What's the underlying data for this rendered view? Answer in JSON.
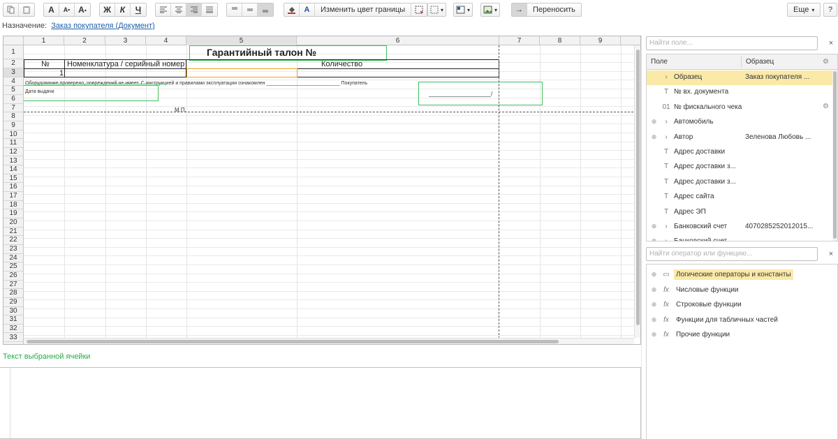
{
  "toolbar": {
    "change_border_color": "Изменить цвет границы",
    "wrap": "Переносить",
    "more": "Еще",
    "help": "?",
    "bold_glyph": "Ж",
    "italic_glyph": "К",
    "underline_glyph": "Ч",
    "font_glyph": "A",
    "dropdown_glyph": "▾"
  },
  "purpose": {
    "label": "Назначение:",
    "link": "Заказ покупателя (Документ)"
  },
  "sheet": {
    "columns": [
      "1",
      "2",
      "3",
      "4",
      "5",
      "6",
      "7",
      "8",
      "9"
    ],
    "rows": [
      "1",
      "2",
      "3",
      "4",
      "5",
      "6",
      "7",
      "8",
      "9",
      "10",
      "11",
      "12",
      "13",
      "14",
      "15",
      "16",
      "17",
      "18",
      "19",
      "20",
      "21",
      "22",
      "23",
      "24",
      "25",
      "26",
      "27",
      "28",
      "29",
      "30",
      "31",
      "32",
      "33"
    ],
    "title": "Гарантийный талон №",
    "header_no": "№",
    "header_item": "Номенклатура / серийный номер",
    "header_qty": "Количество",
    "row3_value": "1",
    "equipment_text": "Оборудование проверено, повреждений не имеет. С инструкцией и правилами эксплуатации ознакомлен ___________________________ Покупатель",
    "issue_date": "Дата выдачи",
    "buyer_sign": "____________________/",
    "stamp": "М.П."
  },
  "cell_text": {
    "label": "Текст выбранной ячейки"
  },
  "fields": {
    "search_placeholder": "Найти поле...",
    "head_field": "Поле",
    "head_sample": "Образец",
    "items": [
      {
        "expander": "",
        "icon": "›",
        "name": "Образец",
        "sample": "Заказ покупателя ...",
        "extra": ""
      },
      {
        "expander": "",
        "icon": "T",
        "name": "№ вх. документа",
        "sample": "",
        "extra": ""
      },
      {
        "expander": "",
        "icon": "01",
        "name": "№ фискального чека",
        "sample": "",
        "extra": "⚙"
      },
      {
        "expander": "⊕",
        "icon": "›",
        "name": "Автомобиль",
        "sample": "",
        "extra": ""
      },
      {
        "expander": "⊕",
        "icon": "›",
        "name": "Автор",
        "sample": "Зеленова Любовь ...",
        "extra": ""
      },
      {
        "expander": "",
        "icon": "T",
        "name": "Адрес доставки",
        "sample": "",
        "extra": ""
      },
      {
        "expander": "",
        "icon": "T",
        "name": "Адрес доставки з...",
        "sample": "",
        "extra": ""
      },
      {
        "expander": "",
        "icon": "T",
        "name": "Адрес доставки з...",
        "sample": "",
        "extra": ""
      },
      {
        "expander": "",
        "icon": "T",
        "name": "Адрес сайта",
        "sample": "",
        "extra": ""
      },
      {
        "expander": "",
        "icon": "T",
        "name": "Адрес ЭП",
        "sample": "",
        "extra": ""
      },
      {
        "expander": "⊕",
        "icon": "›",
        "name": "Банковский счет",
        "sample": "4070285252012015...",
        "extra": ""
      },
      {
        "expander": "⊕",
        "icon": "›",
        "name": "Банковский счет",
        "sample": "",
        "extra": ""
      }
    ]
  },
  "operators": {
    "search_placeholder": "Найти оператор или функцию...",
    "items": [
      {
        "icon": "▭",
        "name": "Логические операторы и константы"
      },
      {
        "icon": "fx",
        "name": "Числовые функции"
      },
      {
        "icon": "fx",
        "name": "Строковые функции"
      },
      {
        "icon": "fx",
        "name": "Функции для табличных частей"
      },
      {
        "icon": "fx",
        "name": "Прочие функции"
      }
    ]
  },
  "colors": {
    "accent_green": "#3fc15c",
    "selection_yellow": "#fbe9a8",
    "link_blue": "#1f5fa8",
    "cell_orange": "#f0a020"
  }
}
